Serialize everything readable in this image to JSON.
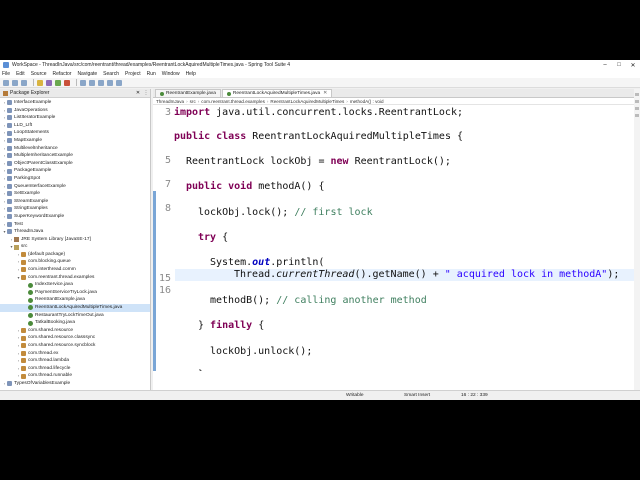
{
  "window": {
    "title": "WorkSpace - ThreadInJava/src/com/reentrant/thread/examples/ReentrantLockAquiredMultipleTimes.java - Spring Tool Suite 4"
  },
  "menu": [
    "File",
    "Edit",
    "Source",
    "Refactor",
    "Navigate",
    "Search",
    "Project",
    "Run",
    "Window",
    "Help"
  ],
  "explorer": {
    "title": "Package Explorer",
    "items": [
      {
        "label": "InterfaceExample",
        "type": "proj",
        "depth": 0
      },
      {
        "label": "JavaOperations",
        "type": "proj",
        "depth": 0
      },
      {
        "label": "ListIteratorExample",
        "type": "proj",
        "depth": 0
      },
      {
        "label": "LLD_LIft",
        "type": "proj",
        "depth": 0
      },
      {
        "label": "LoopStatements",
        "type": "proj",
        "depth": 0
      },
      {
        "label": "MapExample",
        "type": "proj",
        "depth": 0
      },
      {
        "label": "MultilevelInheritance",
        "type": "proj",
        "depth": 0
      },
      {
        "label": "MultipleInheritanceExample",
        "type": "proj",
        "depth": 0
      },
      {
        "label": "ObjectParentClassExample",
        "type": "proj",
        "depth": 0
      },
      {
        "label": "PackageExample",
        "type": "proj",
        "depth": 0
      },
      {
        "label": "ParkingSpot",
        "type": "proj",
        "depth": 0
      },
      {
        "label": "QueueInterfaceExample",
        "type": "proj",
        "depth": 0
      },
      {
        "label": "SetExample",
        "type": "proj",
        "depth": 0
      },
      {
        "label": "StreamExample",
        "type": "proj",
        "depth": 0
      },
      {
        "label": "StringExamples",
        "type": "proj",
        "depth": 0
      },
      {
        "label": "SuperKeywordExample",
        "type": "proj",
        "depth": 0
      },
      {
        "label": "Test",
        "type": "proj",
        "depth": 0
      },
      {
        "label": "ThreadInJava",
        "type": "proj",
        "depth": 0
      },
      {
        "label": "JRE System Library [JavaSE-17]",
        "type": "lib",
        "depth": 1
      },
      {
        "label": "src",
        "type": "src",
        "depth": 1
      },
      {
        "label": "(default package)",
        "type": "pkg",
        "depth": 2
      },
      {
        "label": "com.blocking.queue",
        "type": "pkg",
        "depth": 2
      },
      {
        "label": "com.interthread.comm",
        "type": "pkg",
        "depth": 2
      },
      {
        "label": "com.reentrant.thread.examples",
        "type": "pkg",
        "depth": 2
      },
      {
        "label": "IndexService.java",
        "type": "java",
        "depth": 3
      },
      {
        "label": "PaymentServiceTryLock.java",
        "type": "java",
        "depth": 3
      },
      {
        "label": "ReentrantExample.java",
        "type": "java",
        "depth": 3
      },
      {
        "label": "ReentrantLockAquiredMultipleTimes.java",
        "type": "java",
        "depth": 3,
        "selected": true
      },
      {
        "label": "RestaurantTryLockTimeOut.java",
        "type": "java",
        "depth": 3
      },
      {
        "label": "TatkalBooking.java",
        "type": "java",
        "depth": 3
      },
      {
        "label": "com.shared.resource",
        "type": "pkg",
        "depth": 2
      },
      {
        "label": "com.shared.resource.classsync",
        "type": "pkg",
        "depth": 2
      },
      {
        "label": "com.shared.resource.syncblock",
        "type": "pkg",
        "depth": 2
      },
      {
        "label": "com.thread.ex",
        "type": "pkg",
        "depth": 2
      },
      {
        "label": "com.thread.lambda",
        "type": "pkg",
        "depth": 2
      },
      {
        "label": "com.thread.lifecycle",
        "type": "pkg",
        "depth": 2
      },
      {
        "label": "com.thread.runnable",
        "type": "pkg",
        "depth": 2
      },
      {
        "label": "TypesOfVariablesExample",
        "type": "proj",
        "depth": 0
      }
    ]
  },
  "tabs": [
    {
      "label": "ReentrantExample.java",
      "active": false
    },
    {
      "label": "ReentrantLockAquiredMultipleTimes.java",
      "active": true
    }
  ],
  "breadcrumb": [
    "ThreadInJava",
    "src",
    "com.reentrant.thread.examples",
    "ReentrantLockAquiredMultipleTimes",
    "methodA() : void"
  ],
  "code": {
    "line_numbers": [
      "3",
      "",
      "5",
      "",
      "7",
      "8",
      "",
      "",
      "",
      "",
      "",
      "",
      "15",
      "16",
      "",
      "",
      "",
      "",
      "",
      "",
      "",
      ""
    ],
    "lines": [
      "import java.util.concurrent.locks.ReentrantLock;",
      "public class ReentrantLockAquiredMultipleTimes {",
      "ReentrantLock lockObj = new ReentrantLock();",
      "public void methodA() {",
      "lockObj.lock(); // first lock",
      "try {",
      "System.out.println(",
      "Thread.currentThread().getName() + \" acquired lock in methodA\");",
      "methodB(); // calling another method",
      "} finally {",
      "lockObj.unlock();",
      "}"
    ]
  },
  "status": {
    "mode": "Writable",
    "insert": "Smart Insert",
    "position": "16 : 22 : 339"
  }
}
